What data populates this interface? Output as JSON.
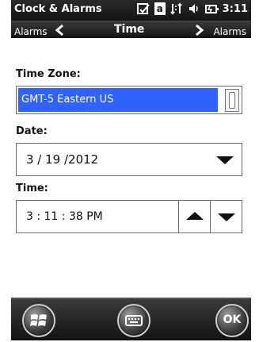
{
  "status_bar": {
    "title": "Clock & Alarms",
    "icons": [
      "checkbox-icon",
      "text-a-icon",
      "connectivity-icon",
      "volume-icon",
      "battery-icon"
    ],
    "time": "3:11"
  },
  "nav": {
    "left_label": "Alarms",
    "center_label": "Time",
    "right_label": "Alarms"
  },
  "form": {
    "timezone_label": "Time Zone:",
    "timezone_value": "GMT-5 Eastern US",
    "date_label": "Date:",
    "date_value": "3  /  19  /2012",
    "time_label": "Time:",
    "time_value": "3  :  11  :  38   PM"
  },
  "colors": {
    "accent": "#2f62ff"
  }
}
